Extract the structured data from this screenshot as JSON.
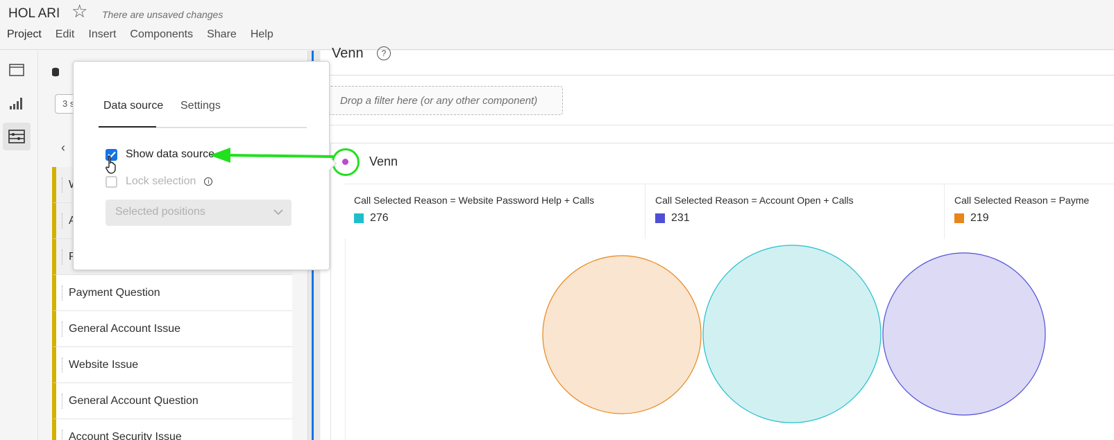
{
  "header": {
    "title": "HOL ARI",
    "status": "There are unsaved changes",
    "menu": [
      "Project",
      "Edit",
      "Insert",
      "Components",
      "Share",
      "Help"
    ]
  },
  "panel": {
    "select_value": "3 s",
    "list": [
      {
        "label": "W"
      },
      {
        "label": "A"
      },
      {
        "label": "P"
      },
      {
        "label": "Payment Question"
      },
      {
        "label": "General Account Issue"
      },
      {
        "label": "Website Issue"
      },
      {
        "label": "General Account Question"
      },
      {
        "label": "Account Security Issue"
      }
    ]
  },
  "popover": {
    "tabs": [
      "Data source",
      "Settings"
    ],
    "show_data_source": "Show data source",
    "lock_selection": "Lock selection",
    "positions_placeholder": "Selected positions"
  },
  "main": {
    "panel_title": "Venn",
    "dropzone": "Drop a filter here (or any other component)",
    "viz_title": "Venn",
    "legend": [
      {
        "name": "Call Selected Reason = Website Password Help + Calls",
        "value": "276",
        "color": "#1ebfcb"
      },
      {
        "name": "Call Selected Reason = Account Open + Calls",
        "value": "231",
        "color": "#4f4fd6"
      },
      {
        "name": "Call Selected Reason = Payme",
        "value": "219",
        "color": "#e8861b"
      }
    ]
  },
  "colors": {
    "accent_blue": "#1473e6",
    "annotation_green": "#22e01e",
    "dimension_yellow": "#d4b000"
  }
}
